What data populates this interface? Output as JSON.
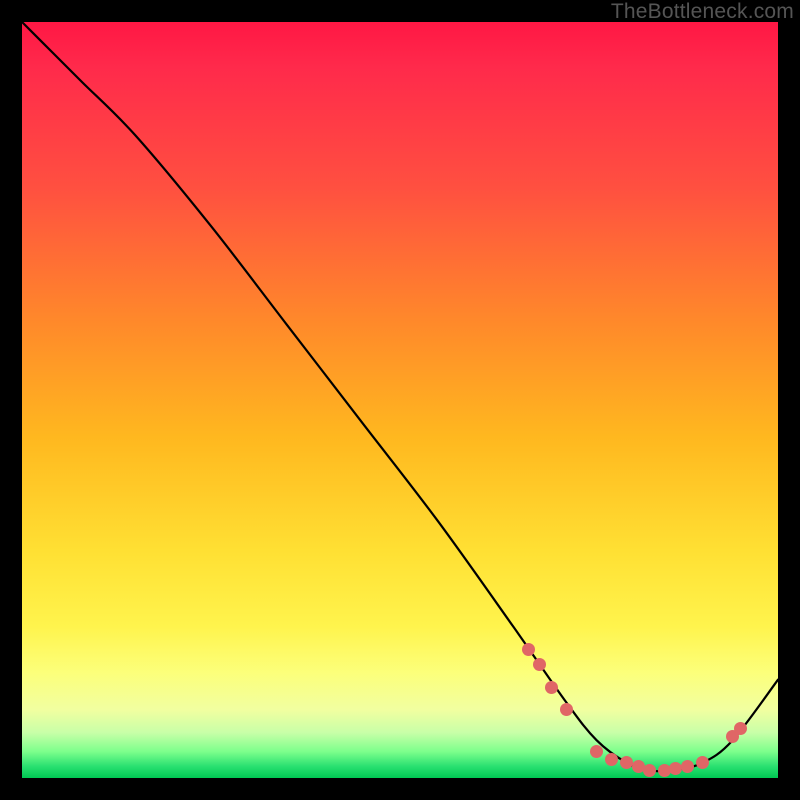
{
  "watermark": "TheBottleneck.com",
  "chart_data": {
    "type": "line",
    "title": "",
    "xlabel": "",
    "ylabel": "",
    "xlim": [
      0,
      100
    ],
    "ylim": [
      0,
      100
    ],
    "grid": false,
    "legend": false,
    "background_gradient": {
      "stops": [
        {
          "pos": 0,
          "color": "#ff1744"
        },
        {
          "pos": 0.22,
          "color": "#ff5040"
        },
        {
          "pos": 0.4,
          "color": "#ff8a2a"
        },
        {
          "pos": 0.55,
          "color": "#ffb81f"
        },
        {
          "pos": 0.7,
          "color": "#ffe033"
        },
        {
          "pos": 0.86,
          "color": "#fcff7a"
        },
        {
          "pos": 0.96,
          "color": "#7dff8c"
        },
        {
          "pos": 1.0,
          "color": "#00c853"
        }
      ]
    },
    "series": [
      {
        "name": "curve",
        "x": [
          0,
          4,
          8,
          15,
          25,
          35,
          45,
          55,
          65,
          72,
          76,
          80,
          83,
          86,
          90,
          94,
          100
        ],
        "y": [
          100,
          96,
          92,
          85,
          73,
          60,
          47,
          34,
          20,
          10,
          5,
          2,
          1,
          1,
          2,
          5,
          13
        ]
      }
    ],
    "markers": [
      {
        "x": 67,
        "y": 17
      },
      {
        "x": 68.5,
        "y": 15
      },
      {
        "x": 70,
        "y": 12
      },
      {
        "x": 72,
        "y": 9
      },
      {
        "x": 76,
        "y": 3.5
      },
      {
        "x": 78,
        "y": 2.5
      },
      {
        "x": 80,
        "y": 2
      },
      {
        "x": 81.5,
        "y": 1.5
      },
      {
        "x": 83,
        "y": 1
      },
      {
        "x": 85,
        "y": 1
      },
      {
        "x": 86.5,
        "y": 1.2
      },
      {
        "x": 88,
        "y": 1.5
      },
      {
        "x": 90,
        "y": 2
      },
      {
        "x": 94,
        "y": 5.5
      },
      {
        "x": 95,
        "y": 6.5
      }
    ]
  }
}
